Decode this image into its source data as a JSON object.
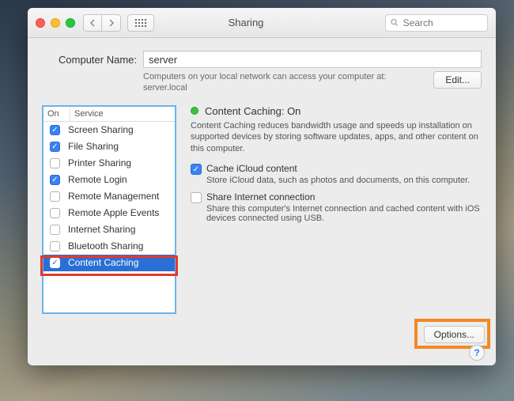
{
  "window": {
    "title": "Sharing"
  },
  "search": {
    "placeholder": "Search"
  },
  "computerName": {
    "label": "Computer Name:",
    "value": "server",
    "hint": "Computers on your local network can access your computer at: server.local",
    "editLabel": "Edit..."
  },
  "services": {
    "headOn": "On",
    "headService": "Service",
    "items": [
      {
        "label": "Screen Sharing",
        "checked": true,
        "selected": false
      },
      {
        "label": "File Sharing",
        "checked": true,
        "selected": false
      },
      {
        "label": "Printer Sharing",
        "checked": false,
        "selected": false
      },
      {
        "label": "Remote Login",
        "checked": true,
        "selected": false
      },
      {
        "label": "Remote Management",
        "checked": false,
        "selected": false
      },
      {
        "label": "Remote Apple Events",
        "checked": false,
        "selected": false
      },
      {
        "label": "Internet Sharing",
        "checked": false,
        "selected": false
      },
      {
        "label": "Bluetooth Sharing",
        "checked": false,
        "selected": false
      },
      {
        "label": "Content Caching",
        "checked": true,
        "selected": true
      }
    ]
  },
  "detail": {
    "statusTitle": "Content Caching: On",
    "statusDesc": "Content Caching reduces bandwidth usage and speeds up installation on supported devices by storing software updates, apps, and other content on this computer.",
    "opt1": {
      "label": "Cache iCloud content",
      "sub": "Store iCloud data, such as photos and documents, on this computer.",
      "checked": true
    },
    "opt2": {
      "label": "Share Internet connection",
      "sub": "Share this computer's Internet connection and cached content with iOS devices connected using USB.",
      "checked": false
    },
    "optionsLabel": "Options...",
    "help": "?"
  }
}
